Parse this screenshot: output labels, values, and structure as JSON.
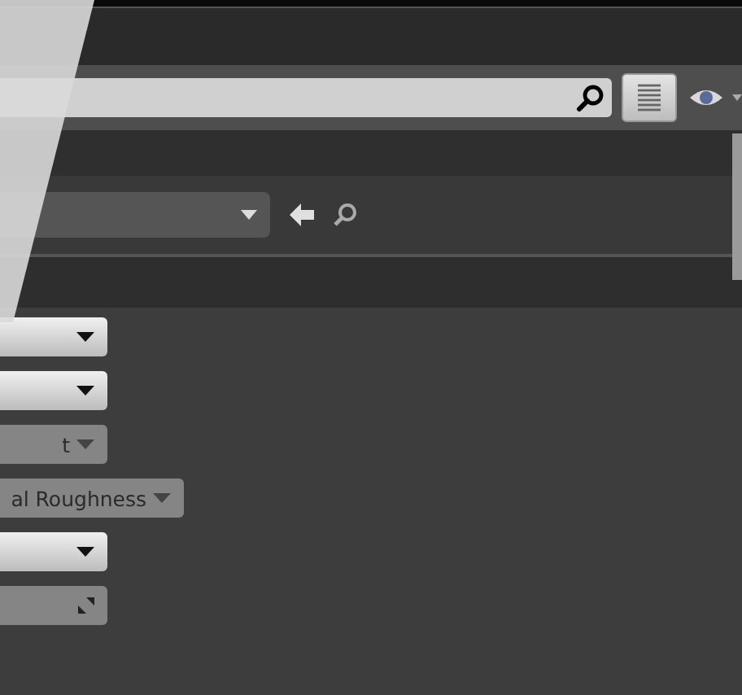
{
  "properties": [
    {
      "kind": "dropdown",
      "disabled": false
    },
    {
      "kind": "dropdown",
      "disabled": false
    },
    {
      "kind": "dropdown",
      "disabled": true,
      "value": "t"
    },
    {
      "kind": "dropdown",
      "disabled": true,
      "value": "al Roughness"
    },
    {
      "kind": "dropdown",
      "disabled": false
    },
    {
      "kind": "expander",
      "disabled": true
    }
  ]
}
